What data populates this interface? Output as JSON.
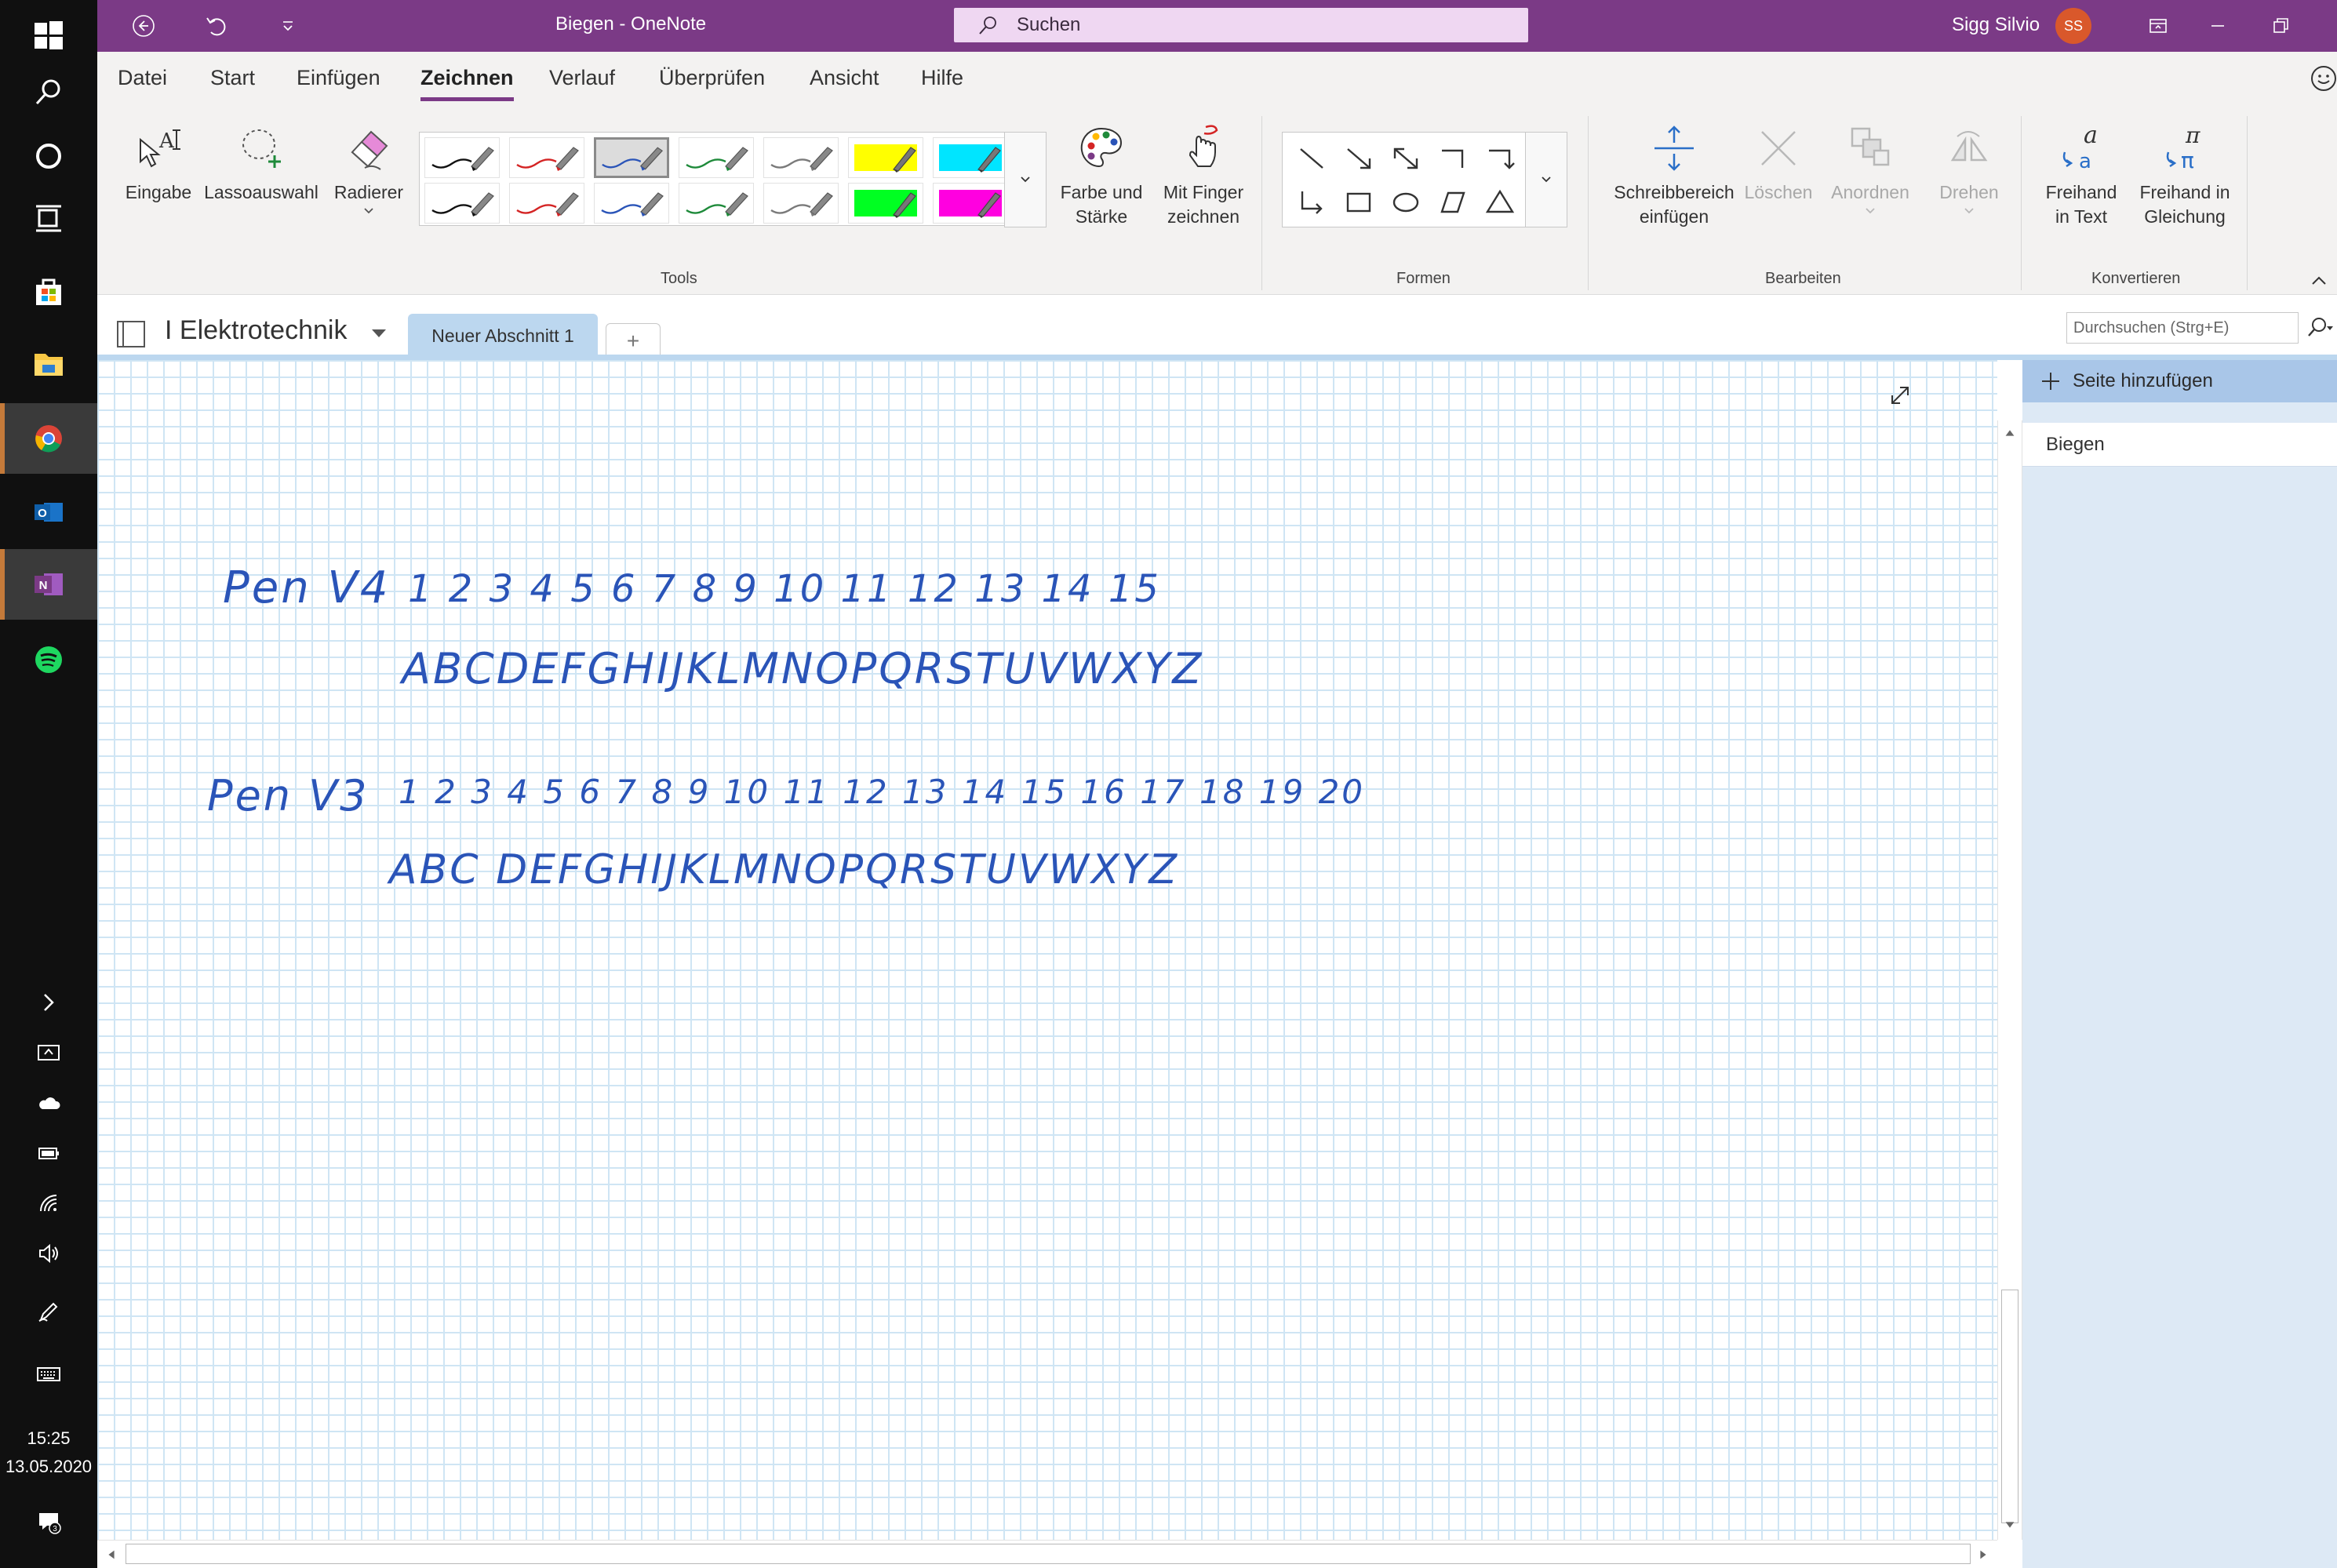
{
  "window": {
    "title": "Biegen  -  OneNote",
    "search_placeholder": "Suchen",
    "user_name": "Sigg Silvio",
    "user_initials": "SS"
  },
  "menu": {
    "tabs": [
      "Datei",
      "Start",
      "Einfügen",
      "Zeichnen",
      "Verlauf",
      "Überprüfen",
      "Ansicht",
      "Hilfe"
    ],
    "active_tab": "Zeichnen"
  },
  "ribbon": {
    "tools": {
      "eingabe": "Eingabe",
      "lasso": "Lassoauswahl",
      "radierer": "Radierer",
      "farbe_line1": "Farbe und",
      "farbe_line2": "Stärke",
      "finger_line1": "Mit Finger",
      "finger_line2": "zeichnen",
      "group_label": "Tools"
    },
    "pens": [
      {
        "color": "#111111",
        "type": "pen"
      },
      {
        "color": "#d42424",
        "type": "pen"
      },
      {
        "color": "#2a54b8",
        "type": "pen",
        "selected": true
      },
      {
        "color": "#1e8a3a",
        "type": "pen"
      },
      {
        "color": "#7a7a7a",
        "type": "pen"
      },
      {
        "color": "#ffff00",
        "type": "highlighter"
      },
      {
        "color": "#00e5ff",
        "type": "highlighter"
      },
      {
        "color": "#111111",
        "type": "pen"
      },
      {
        "color": "#d42424",
        "type": "pen"
      },
      {
        "color": "#2a54b8",
        "type": "pen"
      },
      {
        "color": "#1e8a3a",
        "type": "pen"
      },
      {
        "color": "#7a7a7a",
        "type": "pen"
      },
      {
        "color": "#00ff22",
        "type": "highlighter"
      },
      {
        "color": "#ff00e0",
        "type": "highlighter"
      }
    ],
    "shapes": {
      "group_label": "Formen",
      "items": [
        "line-shape",
        "arrow-shape",
        "double-arrow-shape",
        "elbow-shape",
        "elbow-arrow-shape",
        "elbow-down-arrow-shape",
        "rectangle-shape",
        "ellipse-shape",
        "parallelogram-shape",
        "triangle-shape"
      ]
    },
    "edit": {
      "schreib_line1": "Schreibbereich",
      "schreib_line2": "einfügen",
      "loeschen": "Löschen",
      "anordnen": "Anordnen",
      "drehen": "Drehen",
      "group_label": "Bearbeiten"
    },
    "convert": {
      "freihand_text_line1": "Freihand",
      "freihand_text_line2": "in Text",
      "freihand_gleich_line1": "Freihand in",
      "freihand_gleich_line2": "Gleichung",
      "group_label": "Konvertieren"
    }
  },
  "notebook": {
    "name": "I Elektrotechnik",
    "section": "Neuer Abschnitt 1",
    "add_section": "+",
    "search_placeholder": "Durchsuchen (Strg+E)"
  },
  "canvas": {
    "ink_lines": [
      "Pen V4",
      "1 2 3 4 5 6 7 8 9 10  11 12 13 14 15",
      "ABCDEFGHIJKLMNOPQRSTUVWXYZ",
      "Pen V3",
      "1 2 3 4 5 6 7 8 9 10 11 12 13 14 15 16 17 18 19 20",
      "ABC DEFGHIJKLMNOPQRSTUVWXYZ"
    ],
    "ink_color": "#2a54b8"
  },
  "pages": {
    "add_label": "Seite hinzufügen",
    "items": [
      "Biegen"
    ]
  },
  "taskbar": {
    "time": "15:25",
    "date": "13.05.2020",
    "notification_count": "3"
  }
}
